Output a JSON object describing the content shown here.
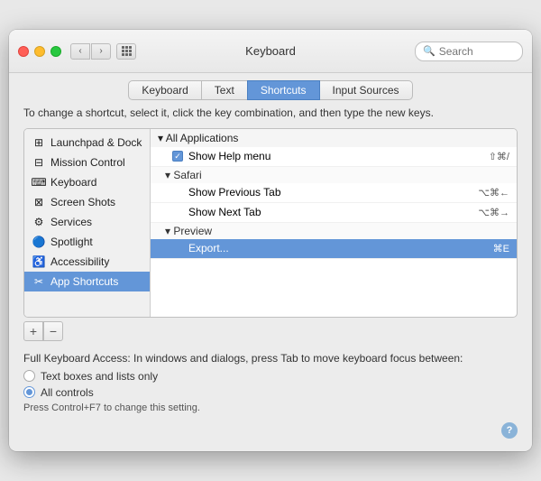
{
  "window": {
    "title": "Keyboard"
  },
  "titlebar": {
    "search_placeholder": "Search"
  },
  "tabs": [
    {
      "label": "Keyboard",
      "id": "keyboard",
      "active": false
    },
    {
      "label": "Text",
      "id": "text",
      "active": false
    },
    {
      "label": "Shortcuts",
      "id": "shortcuts",
      "active": true
    },
    {
      "label": "Input Sources",
      "id": "input-sources",
      "active": false
    }
  ],
  "instruction": "To change a shortcut, select it, click the key combination, and then type the new keys.",
  "sidebar": {
    "items": [
      {
        "label": "Launchpad & Dock",
        "icon": "launchpad",
        "selected": false
      },
      {
        "label": "Mission Control",
        "icon": "mission-control",
        "selected": false
      },
      {
        "label": "Keyboard",
        "icon": "keyboard",
        "selected": false
      },
      {
        "label": "Screen Shots",
        "icon": "screenshot",
        "selected": false
      },
      {
        "label": "Services",
        "icon": "services",
        "selected": false
      },
      {
        "label": "Spotlight",
        "icon": "spotlight",
        "selected": false
      },
      {
        "label": "Accessibility",
        "icon": "accessibility",
        "selected": false
      },
      {
        "label": "App Shortcuts",
        "icon": "app-shortcuts",
        "selected": true
      }
    ]
  },
  "shortcut_groups": [
    {
      "header": "▾ All Applications",
      "rows": [
        {
          "checkbox": true,
          "name": "Show Help menu",
          "key": "⇧⌘/",
          "selected": false
        }
      ],
      "subgroups": [
        {
          "header": "▾ Safari",
          "rows": [
            {
              "checkbox": false,
              "name": "Show Previous Tab",
              "key": "⌥⌘←",
              "selected": false
            },
            {
              "checkbox": false,
              "name": "Show Next Tab",
              "key": "⌥⌘→",
              "selected": false
            }
          ]
        },
        {
          "header": "▾ Preview",
          "rows": [
            {
              "checkbox": false,
              "name": "Export...",
              "key": "⌘E",
              "selected": true
            }
          ]
        }
      ]
    }
  ],
  "add_button_label": "+",
  "remove_button_label": "−",
  "keyboard_access": {
    "title": "Full Keyboard Access: In windows and dialogs, press Tab to move keyboard focus between:",
    "options": [
      {
        "label": "Text boxes and lists only",
        "selected": false
      },
      {
        "label": "All controls",
        "selected": true
      }
    ],
    "note": "Press Control+F7 to change this setting."
  },
  "help_button_label": "?"
}
